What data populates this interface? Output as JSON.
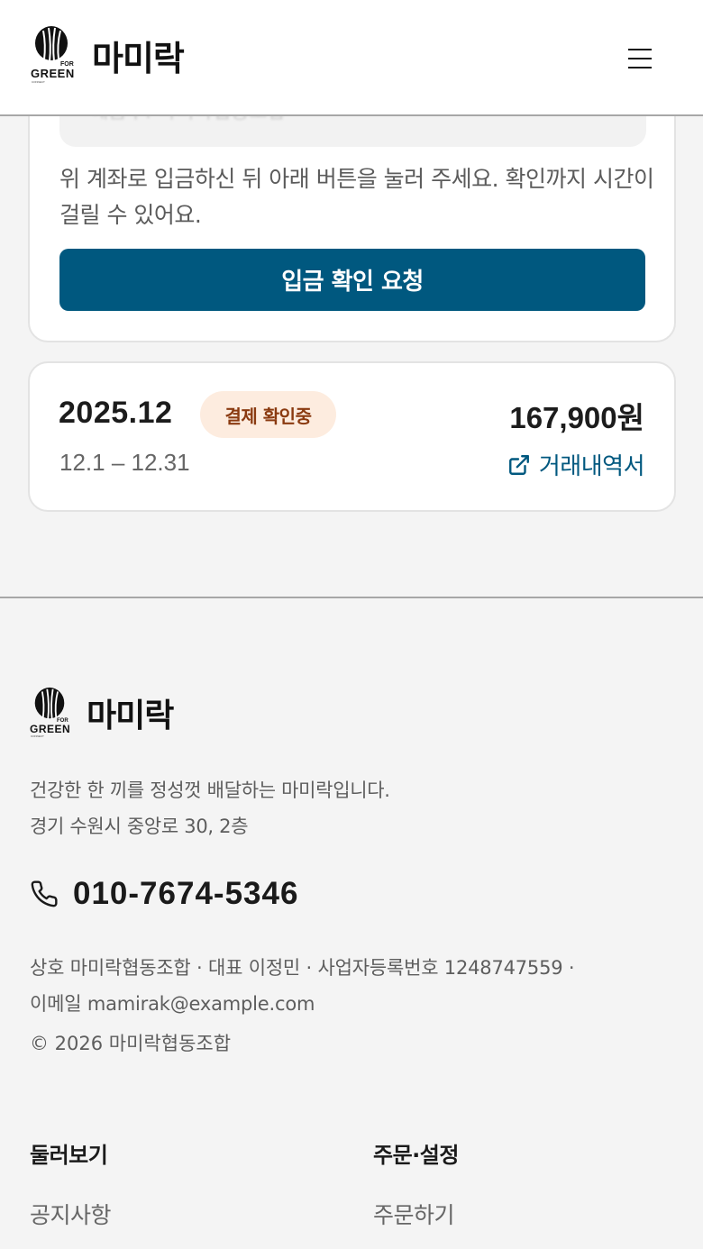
{
  "header": {
    "brand": "마미락",
    "logo": {
      "for": "FOR",
      "green": "GREEN",
      "connect": "CONNECT"
    },
    "menu_icon": "hamburger-menu-icon"
  },
  "deposit": {
    "account_ghost": "예금주: 마미락협동조합",
    "notice": "위 계좌로 입금하신 뒤 아래 버튼을 눌러 주세요. 확인까지 시간이 걸릴 수 있어요.",
    "confirm_button": "입금 확인 요청"
  },
  "bill": {
    "month": "2025.12",
    "status": "결제 확인중",
    "amount": "167,900원",
    "range": "12.1 – 12.31",
    "statement_link": "거래내역서",
    "link_icon": "external-link-icon"
  },
  "footer": {
    "brand": "마미락",
    "description": "건강한 한 끼를 정성껏 배달하는 마미락입니다.",
    "address": "경기 수원시 중앙로 30, 2층",
    "phone": "010-7674-5346",
    "phone_icon": "phone-icon",
    "business_line1": "상호 마미락협동조합 · 대표 이정민 · 사업자등록번호 1248747559 ·",
    "business_line2": "이메일 mamirak@example.com",
    "copyright": "© 2026 마미락협동조합",
    "columns": [
      {
        "heading": "둘러보기",
        "links": [
          "공지사항"
        ]
      },
      {
        "heading": "주문·설정",
        "links": [
          "주문하기"
        ]
      }
    ]
  },
  "colors": {
    "primary": "#00587f",
    "badge_bg": "#fdecdf",
    "badge_text": "#8a3a10",
    "page_bg": "#f4f4f4"
  }
}
